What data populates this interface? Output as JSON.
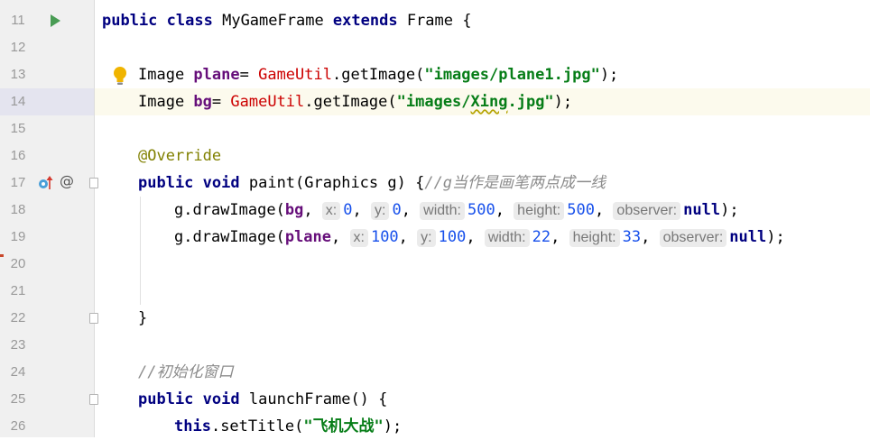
{
  "editor": {
    "lines": [
      {
        "number": "11",
        "tokens": [
          {
            "t": "public",
            "c": "kw"
          },
          {
            "t": " "
          },
          {
            "t": "class",
            "c": "kw"
          },
          {
            "t": " MyGameFrame "
          },
          {
            "t": "extends",
            "c": "kw"
          },
          {
            "t": " Frame {"
          }
        ]
      },
      {
        "number": "12",
        "tokens": []
      },
      {
        "number": "13",
        "tokens": [
          {
            "t": "Image "
          },
          {
            "t": "plane",
            "c": "field"
          },
          {
            "t": "= "
          },
          {
            "t": "GameUtil",
            "c": "cls"
          },
          {
            "t": ".getImage("
          },
          {
            "t": "\"images/plane1.jpg\"",
            "c": "str"
          },
          {
            "t": ");"
          }
        ]
      },
      {
        "number": "14",
        "tokens": [
          {
            "t": "Image "
          },
          {
            "t": "bg",
            "c": "field"
          },
          {
            "t": "= "
          },
          {
            "t": "GameUtil",
            "c": "cls"
          },
          {
            "t": ".getImage("
          },
          {
            "t": "\"images/",
            "c": "str"
          },
          {
            "t": "Xing",
            "c": "str wavy"
          },
          {
            "t": ".jpg\"",
            "c": "str"
          },
          {
            "t": ");"
          }
        ]
      },
      {
        "number": "15",
        "tokens": []
      },
      {
        "number": "16",
        "tokens": [
          {
            "t": "@Override",
            "c": "ann"
          }
        ]
      },
      {
        "number": "17",
        "tokens": [
          {
            "t": "public",
            "c": "kw"
          },
          {
            "t": " "
          },
          {
            "t": "void",
            "c": "kw"
          },
          {
            "t": " paint(Graphics g) {"
          },
          {
            "t": "//g当作是画笔两点成一线",
            "c": "cmt"
          }
        ]
      },
      {
        "number": "18",
        "tokens": [
          {
            "t": "g.drawImage("
          },
          {
            "t": "bg",
            "c": "field"
          },
          {
            "t": ", "
          },
          {
            "t": "x:",
            "c": "hint"
          },
          {
            "t": "0",
            "c": "num"
          },
          {
            "t": ", "
          },
          {
            "t": "y:",
            "c": "hint"
          },
          {
            "t": "0",
            "c": "num"
          },
          {
            "t": ", "
          },
          {
            "t": "width:",
            "c": "hint"
          },
          {
            "t": "500",
            "c": "num"
          },
          {
            "t": ", "
          },
          {
            "t": "height:",
            "c": "hint"
          },
          {
            "t": "500",
            "c": "num"
          },
          {
            "t": ", "
          },
          {
            "t": "observer:",
            "c": "hint"
          },
          {
            "t": "null",
            "c": "kw"
          },
          {
            "t": ");"
          }
        ]
      },
      {
        "number": "19",
        "tokens": [
          {
            "t": "g.drawImage("
          },
          {
            "t": "plane",
            "c": "field"
          },
          {
            "t": ", "
          },
          {
            "t": "x:",
            "c": "hint"
          },
          {
            "t": "100",
            "c": "num"
          },
          {
            "t": ", "
          },
          {
            "t": "y:",
            "c": "hint"
          },
          {
            "t": "100",
            "c": "num"
          },
          {
            "t": ", "
          },
          {
            "t": "width:",
            "c": "hint"
          },
          {
            "t": "22",
            "c": "num"
          },
          {
            "t": ", "
          },
          {
            "t": "height:",
            "c": "hint"
          },
          {
            "t": "33",
            "c": "num"
          },
          {
            "t": ", "
          },
          {
            "t": "observer:",
            "c": "hint"
          },
          {
            "t": "null",
            "c": "kw"
          },
          {
            "t": ");"
          }
        ]
      },
      {
        "number": "20",
        "tokens": []
      },
      {
        "number": "21",
        "tokens": []
      },
      {
        "number": "22",
        "tokens": [
          {
            "t": "}"
          }
        ]
      },
      {
        "number": "23",
        "tokens": []
      },
      {
        "number": "24",
        "tokens": [
          {
            "t": "//初始化窗口",
            "c": "cmt"
          }
        ]
      },
      {
        "number": "25",
        "tokens": [
          {
            "t": "public",
            "c": "kw"
          },
          {
            "t": " "
          },
          {
            "t": "void",
            "c": "kw"
          },
          {
            "t": " launchFrame() {"
          }
        ]
      },
      {
        "number": "26",
        "tokens": [
          {
            "t": "this",
            "c": "kw"
          },
          {
            "t": ".setTitle("
          },
          {
            "t": "\"飞机大战\"",
            "c": "str"
          },
          {
            "t": ");"
          }
        ]
      }
    ],
    "current_line": "14",
    "gutter_icons": {
      "11": "run-icon",
      "13": "lightbulb-icon",
      "17": "override-icon",
      "17b": "annotation-icon",
      "17f": "fold-icon",
      "22f": "fold-icon",
      "25f": "fold-icon"
    }
  }
}
